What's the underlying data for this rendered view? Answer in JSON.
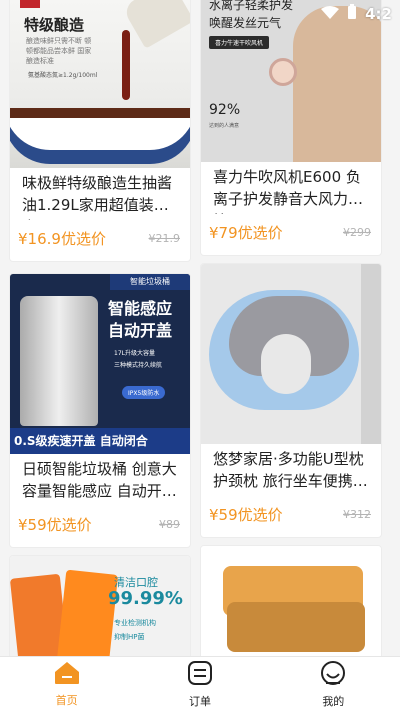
{
  "status_bar": {
    "time": "4:2"
  },
  "products": {
    "left": [
      {
        "title": "味极鲜特级酿造生抽酱油1.29L家用超值装厨房…",
        "price": "¥16.9优选价",
        "original_price": "¥21.9",
        "image": {
          "heading": "特级酿造",
          "subtext": "酿造味鲜只需不断 顿顿都能品尝本鲜 国家酿造标准",
          "volume": "氨基酸态氮≥1.2g/100ml"
        }
      },
      {
        "title": "日硕智能垃圾桶 创意大容量智能感应 自动开…",
        "price": "¥59优选价",
        "original_price": "¥89",
        "image": {
          "badge": "智能垃圾桶",
          "headline_1": "智能感应",
          "headline_2": "自动开盖",
          "feature_1": "17L升级大容量",
          "feature_2": "三种模式持久续航",
          "feature_3": "IPX5级防水",
          "strip": "0.S级疾速开盖 自动闭合"
        }
      },
      {
        "title": "",
        "price": "",
        "original_price": "",
        "image": {
          "line_1": "清洁口腔",
          "line_2": "99.99%",
          "line_3": "专业检测机构",
          "line_4": "抑制HP菌"
        }
      }
    ],
    "right": [
      {
        "title": "喜力牛吹风机E600 负离子护发静音大风力快…",
        "price": "¥79优选价",
        "original_price": "¥299",
        "image": {
          "line_1": "水离子轻柔护发",
          "line_2": "唤醒发丝元气",
          "tag": "喜力牛速干吹风机",
          "percent": "92%",
          "note": "达到的人满意"
        }
      },
      {
        "title": "悠梦家居·多功能U型枕护颈枕 旅行坐车便携…",
        "price": "¥59优选价",
        "original_price": "¥312",
        "image": {}
      },
      {
        "title": "",
        "price": "",
        "original_price": "",
        "image": {}
      }
    ]
  },
  "tabs": [
    {
      "label": "首页",
      "icon": "home-icon",
      "active": true
    },
    {
      "label": "订单",
      "icon": "orders-icon",
      "active": false
    },
    {
      "label": "我的",
      "icon": "profile-icon",
      "active": false
    }
  ],
  "colors": {
    "accent": "#f29422",
    "muted": "#b4b4b4"
  }
}
